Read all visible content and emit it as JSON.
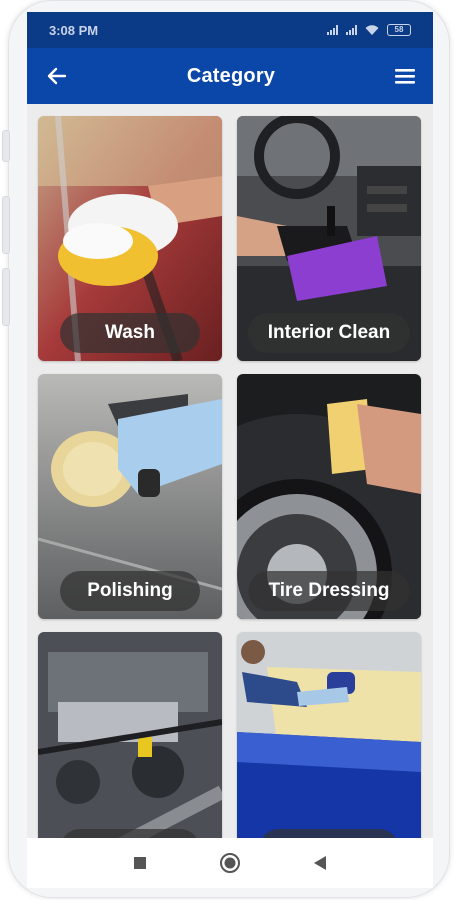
{
  "status_bar": {
    "time": "3:08 PM",
    "battery": "58"
  },
  "app_bar": {
    "title": "Category",
    "back_icon": "arrow-left-icon",
    "menu_icon": "hamburger-menu-icon"
  },
  "categories": [
    {
      "label": "Wash"
    },
    {
      "label": "Interior Clean"
    },
    {
      "label": "Polishing"
    },
    {
      "label": "Tire Dressing"
    },
    {
      "label": ""
    },
    {
      "label": ""
    }
  ],
  "nav_bar": {
    "icons": [
      "square-recent-icon",
      "circle-home-icon",
      "triangle-back-icon"
    ]
  },
  "colors": {
    "status_bar": "#0b3a86",
    "app_bar": "#0a47a9",
    "background": "#ececec",
    "label_pill": "#323232"
  }
}
